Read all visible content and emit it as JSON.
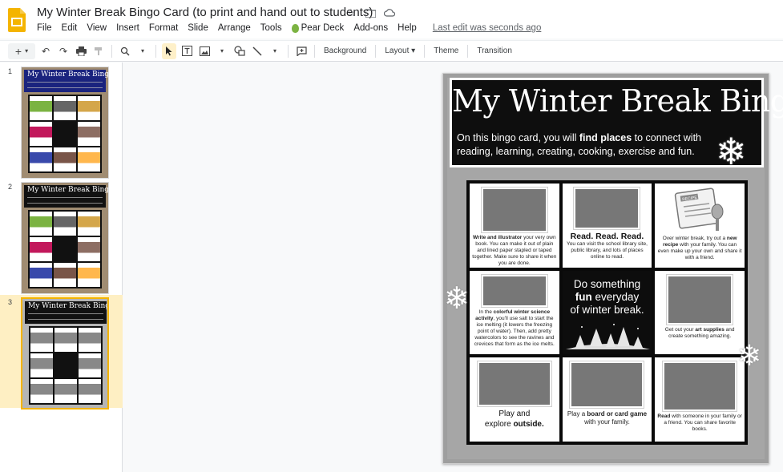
{
  "app": {
    "doc_title": "My Winter Break Bingo Card (to print and hand out to students)",
    "last_edit": "Last edit was seconds ago"
  },
  "menu": [
    "File",
    "Edit",
    "View",
    "Insert",
    "Format",
    "Slide",
    "Arrange",
    "Tools",
    "Pear Deck",
    "Add-ons",
    "Help"
  ],
  "toolbar": {
    "background": "Background",
    "layout": "Layout",
    "theme": "Theme",
    "transition": "Transition"
  },
  "filmstrip": {
    "slides": [
      {
        "number": "1",
        "title": "My Winter Break Bingo"
      },
      {
        "number": "2",
        "title": "My Winter Break Bingo"
      },
      {
        "number": "3",
        "title": "My Winter Break Bingo"
      }
    ],
    "selected": "3"
  },
  "slide": {
    "title": "My Winter Break Bingo",
    "subtitle_pre": "On this bingo card, you will ",
    "subtitle_bold": "find places",
    "subtitle_post": " to connect with reading, learning, creating, cooking, exercise and fun.",
    "cells": {
      "c1": {
        "bold": "Write and illustrator",
        "text": " your very own book. You can make it out of plain and lined paper stapled or taped together. Make sure to share it when you are done."
      },
      "c2": {
        "heading": "Read. Read. Read.",
        "text": "You can visit the school library site, public library, and lots of places online to read."
      },
      "c3": {
        "text_pre": "Over winter break, try out a ",
        "bold": "new recipe",
        "text_post": " with your family. You can even make up your own and share it with a friend.",
        "label": "RECIPE"
      },
      "c4": {
        "text_pre": "In the ",
        "bold": "colorful winter science activity",
        "text_post": ", you'll use salt to start the ice melting (it lowers the freezing point of water). Then, add pretty watercolors to see the ravines and crevices that form as the ice melts."
      },
      "c5": {
        "line1": "Do something",
        "bold": "fun",
        "line2": " everyday",
        "line3": "of winter break."
      },
      "c6": {
        "text_pre": "Get out your ",
        "bold": "art supplies",
        "text_post": " and create something amazing."
      },
      "c7": {
        "line1": "Play and",
        "line2_pre": "explore ",
        "bold": "outside."
      },
      "c8": {
        "text_pre": "Play a ",
        "bold": "board or card game",
        "text_post": " with your family."
      },
      "c9": {
        "bold": "Read",
        "text": " with someone in your family or a friend. You can share favorite books."
      }
    }
  }
}
